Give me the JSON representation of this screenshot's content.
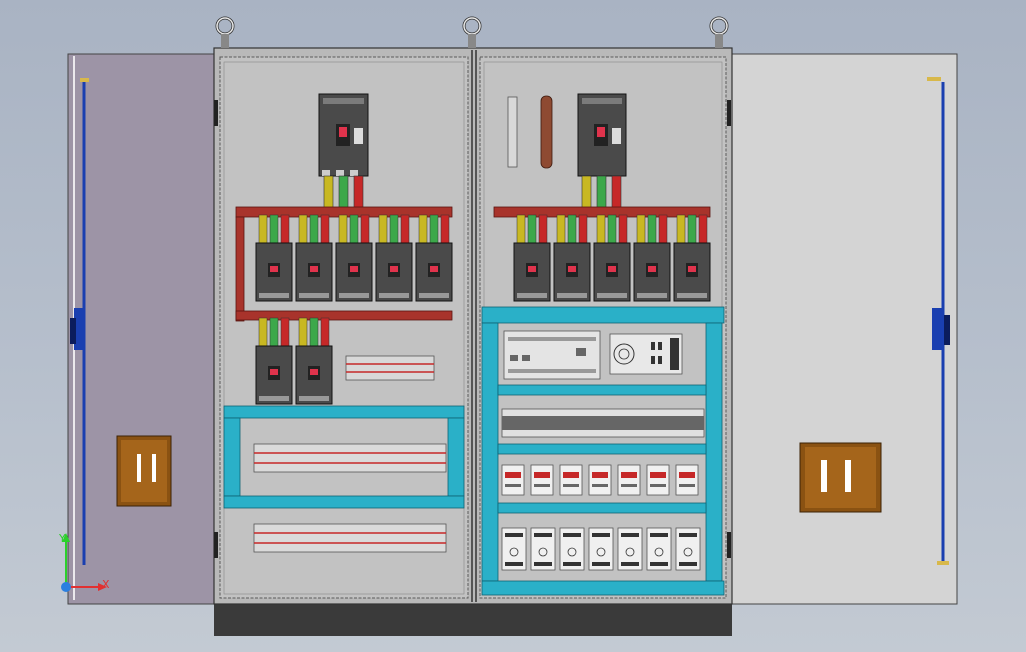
{
  "scene": {
    "axes": {
      "x_label": "X",
      "y_label": "Y"
    },
    "colors": {
      "background": "#b0b9c7",
      "panel": "#c2c2c2",
      "frame": "#b9b9b9",
      "left_door": "#9d94a6",
      "right_door": "#d4d4d4",
      "busbar": "#a8332b",
      "wire_teal": "#2ab0c8",
      "breaker_body": "#4a4a4a",
      "handle": "#c87f2a",
      "rod": "#1a3fb0",
      "plinth": "#3a3a3a"
    },
    "counts": {
      "left_top_breakers": 5,
      "left_bottom_breakers": 2,
      "right_top_breakers": 5,
      "contactors": 7,
      "relays": 7
    }
  }
}
